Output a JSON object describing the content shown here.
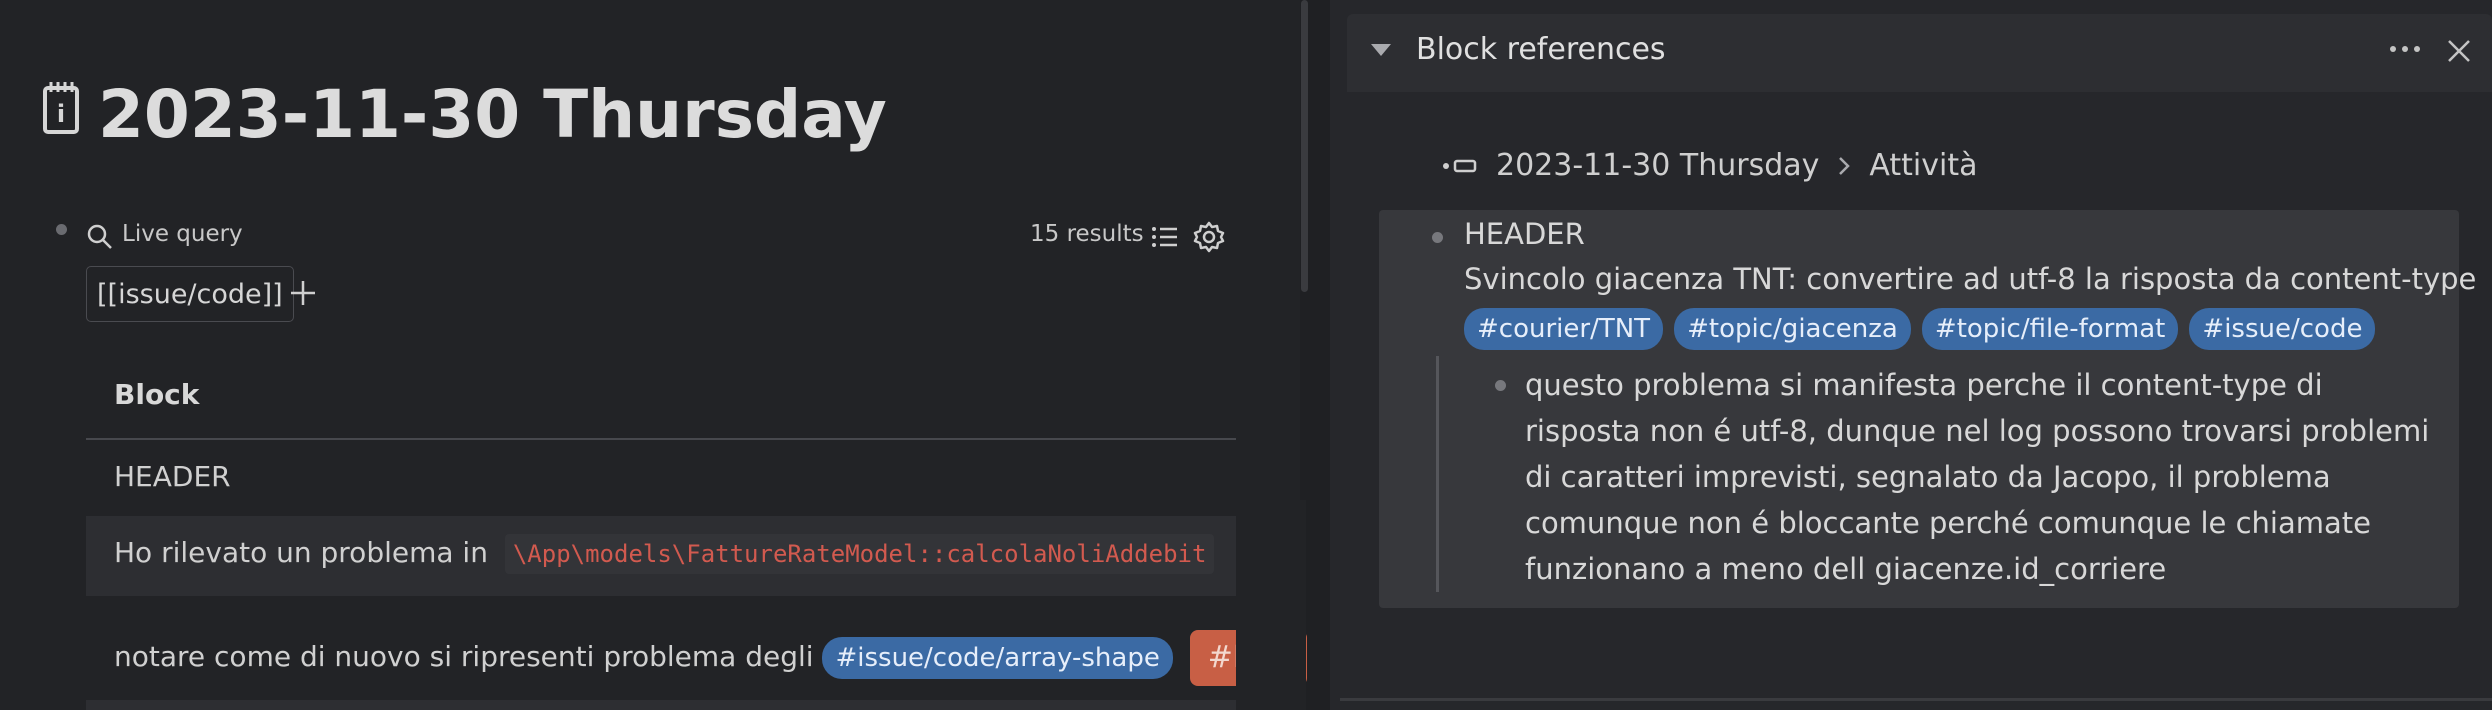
{
  "page": {
    "title": "2023-11-30 Thursday",
    "icon": "journal-icon"
  },
  "query": {
    "label": "Live query",
    "results": "15 results",
    "chip": "[[issue/code]]",
    "column_header": "Block",
    "rows": [
      {
        "text": "HEADER"
      },
      {
        "text": "Ho rilevato un problema in",
        "code": "\\App\\models\\FattureRateModel::calcolaNoliAddebit"
      },
      {
        "text": "notare come di nuovo si ripresenti problema degli",
        "tag": "#issue/code/array-shape",
        "tag2": "#LEA"
      }
    ]
  },
  "panel": {
    "title": "Block references",
    "breadcrumb": [
      "2023-11-30 Thursday",
      "Attività"
    ],
    "ref": {
      "header": "HEADER",
      "line": "Svincolo giacenza TNT: convertire ad utf-8 la risposta da content-type",
      "tags": [
        "#courier/TNT",
        "#topic/giacenza",
        "#topic/file-format",
        "#issue/code"
      ],
      "child": "questo problema si manifesta perche il content-type di risposta non é utf-8, dunque nel log possono trovarsi problemi di caratteri imprevisti, segnalato da Jacopo, il problema comunque non é bloccante perché comunque le chiamate funzionano a meno dell giacenze.id_corriere"
    }
  },
  "colors": {
    "background": "#222326",
    "tag_blue": "#3b6aa4",
    "tag_orange": "#c85f45",
    "code_red": "#d25a4f"
  }
}
